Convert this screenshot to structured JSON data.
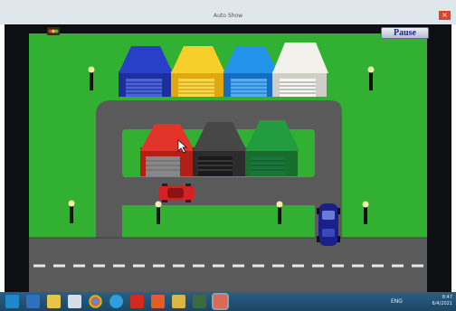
{
  "window": {
    "title": "Auto Show",
    "close_glyph": "×"
  },
  "game": {
    "pause_label": "Pause",
    "hud_icon": "traffic-light-icon",
    "garages_top": [
      {
        "name": "garage-blue",
        "color": "#1c2f9c"
      },
      {
        "name": "garage-yellow",
        "color": "#f3c417"
      },
      {
        "name": "garage-light-blue",
        "color": "#1c86e0"
      },
      {
        "name": "garage-white",
        "color": "#ecebe5"
      }
    ],
    "garages_middle": [
      {
        "name": "garage-red",
        "color": "#d9281f"
      },
      {
        "name": "garage-dark-gray",
        "color": "#3b3b3b"
      },
      {
        "name": "garage-green",
        "color": "#1f8a38"
      }
    ],
    "cars": [
      {
        "name": "red-car",
        "color": "#d42121"
      },
      {
        "name": "blue-car",
        "color": "#19208a"
      }
    ]
  },
  "taskbar": {
    "icons": [
      "windows-start-icon",
      "save-icon",
      "file-explorer-icon",
      "document-icon",
      "chrome-icon",
      "telegram-icon",
      "pdf-icon",
      "office-icon",
      "folder-icon",
      "tool-icon",
      "game-app-icon"
    ],
    "tray_time": "8:47",
    "tray_date": "6/4/2021",
    "tray_lang": "ENG"
  }
}
